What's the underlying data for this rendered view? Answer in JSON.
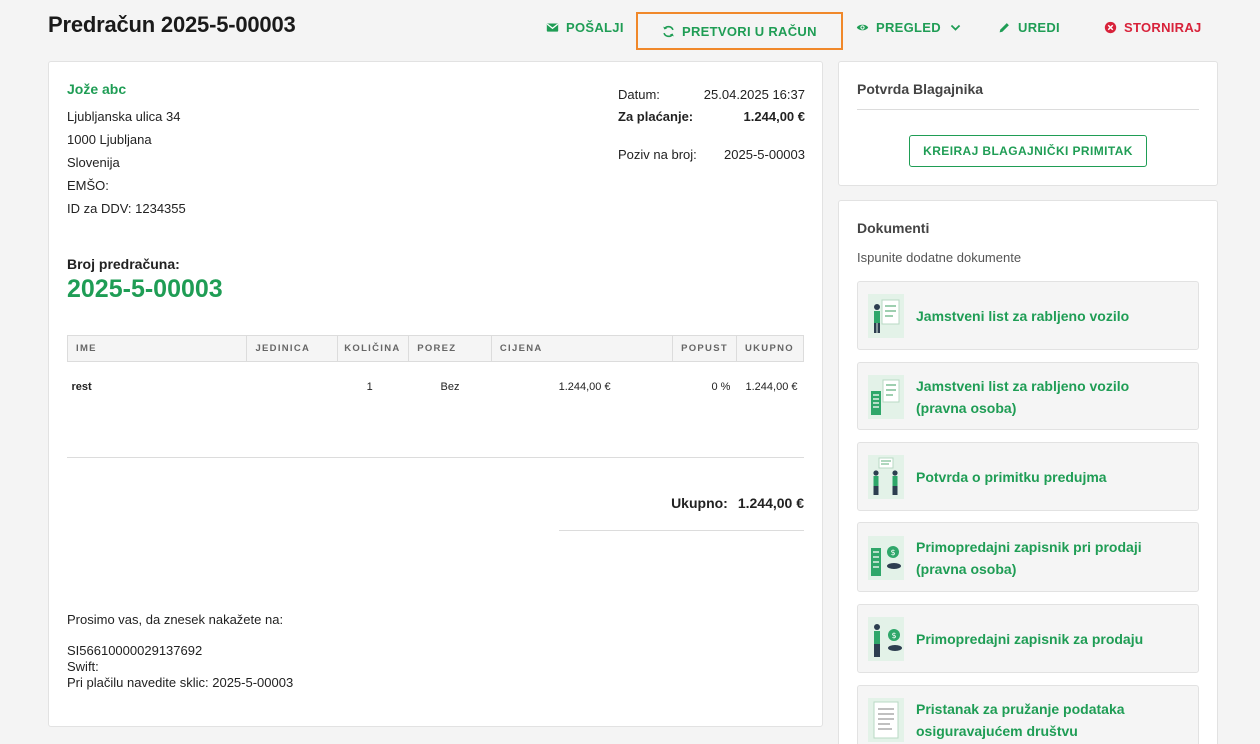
{
  "header": {
    "title": "Predračun 2025-5-00003",
    "actions": {
      "send": "POŠALJI",
      "convert": "PRETVORI U RAČUN",
      "preview": "PREGLED",
      "edit": "UREDI",
      "cancel": "STORNIRAJ"
    }
  },
  "client": {
    "name": "Jože abc",
    "street": "Ljubljanska ulica 34",
    "city": "1000 Ljubljana",
    "country": "Slovenija",
    "emso": "EMŠO:",
    "vat": "ID za DDV: 1234355"
  },
  "meta": {
    "date_label": "Datum:",
    "date_value": "25.04.2025 16:37",
    "due_label": "Za plaćanje:",
    "due_value": "1.244,00 €",
    "ref_label": "Poziv na broj:",
    "ref_value": "2025-5-00003"
  },
  "number": {
    "label": "Broj predračuna:",
    "value": "2025-5-00003"
  },
  "table": {
    "headers": [
      "IME",
      "JEDINICA",
      "KOLIČINA",
      "POREZ",
      "CIJENA",
      "POPUST",
      "UKUPNO"
    ],
    "rows": [
      [
        "rest",
        "",
        "1",
        "Bez",
        "1.244,00 €",
        "0 %",
        "1.244,00 €"
      ]
    ]
  },
  "total": {
    "label": "Ukupno:",
    "value": "1.244,00 €"
  },
  "payment": {
    "intro": "Prosimo vas, da znesek nakažete na:",
    "iban": "SI56610000029137692",
    "swift": "Swift:",
    "reference": "Pri plačilu navedite sklic: 2025-5-00003"
  },
  "cashier": {
    "title": "Potvrda Blagajnika",
    "button": "KREIRAJ BLAGAJNIČKI PRIMITAK"
  },
  "documents": {
    "title": "Dokumenti",
    "subtitle": "Ispunite dodatne dokumente",
    "items": [
      {
        "line1": "Jamstveni list za rabljeno vozilo",
        "line2": ""
      },
      {
        "line1": "Jamstveni list za rabljeno vozilo",
        "line2": "(pravna osoba)"
      },
      {
        "line1": "Potvrda o primitku predujma",
        "line2": ""
      },
      {
        "line1": "Primopredajni zapisnik pri prodaji",
        "line2": "(pravna osoba)"
      },
      {
        "line1": "Primopredajni zapisnik za prodaju",
        "line2": ""
      },
      {
        "line1": "Pristanak za pružanje podataka",
        "line2": "osiguravajućem društvu"
      }
    ]
  },
  "colors": {
    "accent": "#1f9d55",
    "danger": "#d8223a",
    "highlight": "#f0882a"
  }
}
